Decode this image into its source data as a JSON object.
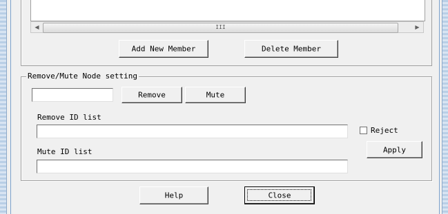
{
  "members": {
    "scroll_thumb_glyph": "III",
    "scroll_left_glyph": "◀",
    "scroll_right_glyph": "▶",
    "add_label": "Add New Member",
    "delete_label": "Delete Member"
  },
  "remove_mute": {
    "group_title": "Remove/Mute Node setting",
    "node_input_value": "",
    "remove_label": "Remove",
    "mute_label": "Mute",
    "remove_list_label": "Remove ID list",
    "remove_list_value": "",
    "reject_label": "Reject",
    "reject_checked": false,
    "mute_list_label": "Mute ID list",
    "mute_list_value": "",
    "apply_label": "Apply"
  },
  "footer": {
    "help_label": "Help",
    "close_label": "Close"
  }
}
